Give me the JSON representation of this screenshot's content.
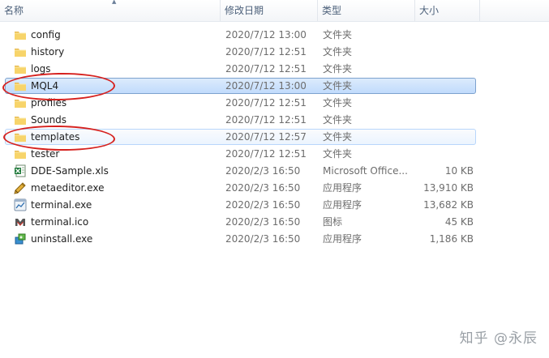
{
  "columns": {
    "name": "名称",
    "date": "修改日期",
    "type": "类型",
    "size": "大小"
  },
  "rows": [
    {
      "name": "config",
      "date": "2020/7/12 13:00",
      "type": "文件夹",
      "size": "",
      "icon": "folder-icon",
      "state": "normal"
    },
    {
      "name": "history",
      "date": "2020/7/12 12:51",
      "type": "文件夹",
      "size": "",
      "icon": "folder-icon",
      "state": "normal"
    },
    {
      "name": "logs",
      "date": "2020/7/12 12:51",
      "type": "文件夹",
      "size": "",
      "icon": "folder-icon",
      "state": "normal"
    },
    {
      "name": "MQL4",
      "date": "2020/7/12 13:00",
      "type": "文件夹",
      "size": "",
      "icon": "folder-icon",
      "state": "selected"
    },
    {
      "name": "profiles",
      "date": "2020/7/12 12:51",
      "type": "文件夹",
      "size": "",
      "icon": "folder-icon",
      "state": "normal"
    },
    {
      "name": "Sounds",
      "date": "2020/7/12 12:51",
      "type": "文件夹",
      "size": "",
      "icon": "folder-icon",
      "state": "normal"
    },
    {
      "name": "templates",
      "date": "2020/7/12 12:57",
      "type": "文件夹",
      "size": "",
      "icon": "folder-icon",
      "state": "hovered"
    },
    {
      "name": "tester",
      "date": "2020/7/12 12:51",
      "type": "文件夹",
      "size": "",
      "icon": "folder-icon",
      "state": "normal"
    },
    {
      "name": "DDE-Sample.xls",
      "date": "2020/2/3 16:50",
      "type": "Microsoft Office...",
      "size": "10 KB",
      "icon": "excel-file-icon",
      "state": "normal"
    },
    {
      "name": "metaeditor.exe",
      "date": "2020/2/3 16:50",
      "type": "应用程序",
      "size": "13,910 KB",
      "icon": "metaeditor-app-icon",
      "state": "normal"
    },
    {
      "name": "terminal.exe",
      "date": "2020/2/3 16:50",
      "type": "应用程序",
      "size": "13,682 KB",
      "icon": "terminal-app-icon",
      "state": "normal"
    },
    {
      "name": "terminal.ico",
      "date": "2020/2/3 16:50",
      "type": "图标",
      "size": "45 KB",
      "icon": "metatrader-logo-icon",
      "state": "normal"
    },
    {
      "name": "uninstall.exe",
      "date": "2020/2/3 16:50",
      "type": "应用程序",
      "size": "1,186 KB",
      "icon": "uninstall-app-icon",
      "state": "normal"
    }
  ],
  "annotation_color": "#d6211e",
  "selection_color": "#c1dbfc",
  "watermark": "知乎 @永辰"
}
